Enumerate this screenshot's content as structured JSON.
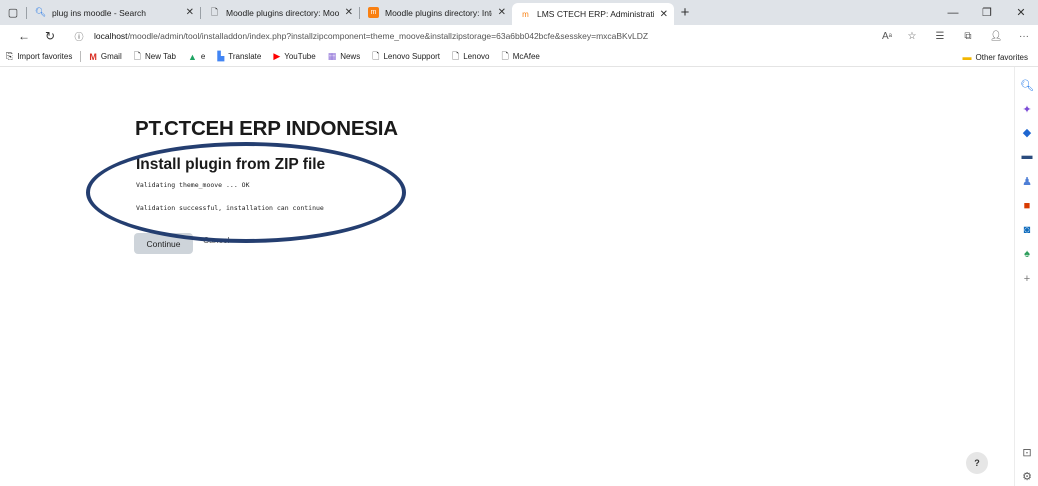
{
  "tabs": [
    {
      "label": "plug ins moodle - Search",
      "icon": "search-icon"
    },
    {
      "label": "Moodle plugins directory: Moov",
      "icon": "page-icon"
    },
    {
      "label": "Moodle plugins directory: Intera",
      "icon": "moodle-icon"
    },
    {
      "label": "LMS CTECH ERP: Administration",
      "icon": "moodle-hat-icon"
    }
  ],
  "address": {
    "host": "localhost",
    "path": "/moodle/admin/tool/installaddon/index.php?installzipcomponent=theme_moove&installzipstorage=63a6bb042bcfe&sesskey=mxcaBKvLDZ"
  },
  "bookmarks": [
    {
      "label": "Import favorites"
    },
    {
      "label": "Gmail"
    },
    {
      "label": "New Tab"
    },
    {
      "label": "e"
    },
    {
      "label": "Translate"
    },
    {
      "label": "YouTube"
    },
    {
      "label": "News"
    },
    {
      "label": "Lenovo Support"
    },
    {
      "label": "Lenovo"
    },
    {
      "label": "McAfee"
    }
  ],
  "other_favorites": "Other favorites",
  "page": {
    "site_title": "PT.CTCEH ERP INDONESIA",
    "heading": "Install plugin from ZIP file",
    "log_line_1": "Validating theme_moove ... OK",
    "log_line_2": "Validation successful, installation can continue",
    "continue_label": "Continue",
    "cancel_label": "Cancel"
  },
  "help_label": "?",
  "colors": {
    "annotation_ring": "#243e70",
    "continue_button": "#ced4da",
    "tabstrip": "#dfe3e8"
  }
}
